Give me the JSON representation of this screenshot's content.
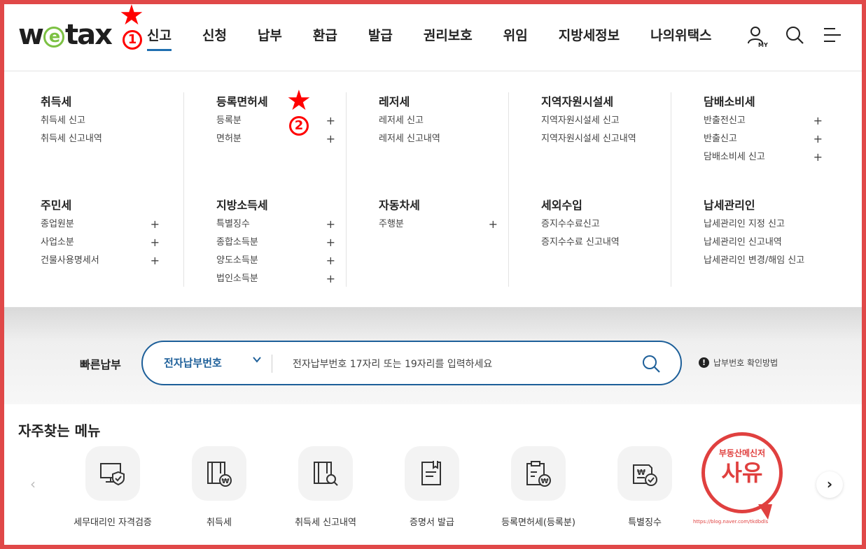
{
  "header": {
    "logo": {
      "pre": "w",
      "e": "e",
      "post": "tax"
    },
    "nav": [
      {
        "label": "신고",
        "active": true
      },
      {
        "label": "신청"
      },
      {
        "label": "납부"
      },
      {
        "label": "환급"
      },
      {
        "label": "발급"
      },
      {
        "label": "권리보호"
      },
      {
        "label": "위임"
      },
      {
        "label": "지방세정보"
      },
      {
        "label": "나의위택스"
      }
    ],
    "my_badge": "MY"
  },
  "annotations": {
    "star1_num": "1",
    "star2_num": "2",
    "star_glyph": "★"
  },
  "mega_menu": {
    "row1": [
      {
        "title": "취득세",
        "items": [
          {
            "label": "취득세 신고"
          },
          {
            "label": "취득세 신고내역"
          }
        ]
      },
      {
        "title": "등록면허세",
        "items": [
          {
            "label": "등록분",
            "plus": true
          },
          {
            "label": "면허분",
            "plus": true
          }
        ]
      },
      {
        "title": "레저세",
        "items": [
          {
            "label": "레저세 신고"
          },
          {
            "label": "레저세 신고내역"
          }
        ]
      },
      {
        "title": "지역자원시설세",
        "items": [
          {
            "label": "지역자원시설세 신고"
          },
          {
            "label": "지역자원시설세 신고내역"
          }
        ]
      },
      {
        "title": "담배소비세",
        "items": [
          {
            "label": "반출전신고",
            "plus": true
          },
          {
            "label": "반출신고",
            "plus": true
          },
          {
            "label": "담배소비세 신고",
            "plus": true
          }
        ]
      }
    ],
    "row2": [
      {
        "title": "주민세",
        "items": [
          {
            "label": "종업원분",
            "plus": true
          },
          {
            "label": "사업소분",
            "plus": true
          },
          {
            "label": "건물사용명세서",
            "plus": true
          }
        ]
      },
      {
        "title": "지방소득세",
        "items": [
          {
            "label": "특별징수",
            "plus": true
          },
          {
            "label": "종합소득분",
            "plus": true
          },
          {
            "label": "양도소득분",
            "plus": true
          },
          {
            "label": "법인소득분",
            "plus": true
          }
        ]
      },
      {
        "title": "자동차세",
        "items": [
          {
            "label": "주행분",
            "plus": true
          }
        ]
      },
      {
        "title": "세외수입",
        "items": [
          {
            "label": "증지수수료신고"
          },
          {
            "label": "증지수수료 신고내역"
          }
        ]
      },
      {
        "title": "납세관리인",
        "items": [
          {
            "label": "납세관리인 지정 신고"
          },
          {
            "label": "납세관리인 신고내역"
          },
          {
            "label": "납세관리인 변경/해임 신고"
          }
        ]
      }
    ],
    "plus_glyph": "+"
  },
  "quick_pay": {
    "label": "빠른납부",
    "select_value": "전자납부번호",
    "placeholder": "전자납부번호 17자리 또는 19자리를 입력하세요",
    "help_icon": "!",
    "help_text": "납부번호 확인방법"
  },
  "favorites": {
    "title": "자주찾는 메뉴",
    "prev_glyph": "‹",
    "next_glyph": "›",
    "items": [
      {
        "label": "세무대리인 자격검증",
        "icon": "monitor-shield-icon"
      },
      {
        "label": "취득세",
        "icon": "envelope-won-icon"
      },
      {
        "label": "취득세 신고내역",
        "icon": "envelope-search-icon"
      },
      {
        "label": "증명서 발급",
        "icon": "document-bookmark-icon"
      },
      {
        "label": "등록면허세(등록분)",
        "icon": "clipboard-won-icon"
      },
      {
        "label": "특별징수",
        "icon": "document-check-icon"
      }
    ]
  },
  "stamp": {
    "top": "부동산메신저",
    "main": "사유",
    "url": "https://blog.naver.com/tkdbdls"
  }
}
